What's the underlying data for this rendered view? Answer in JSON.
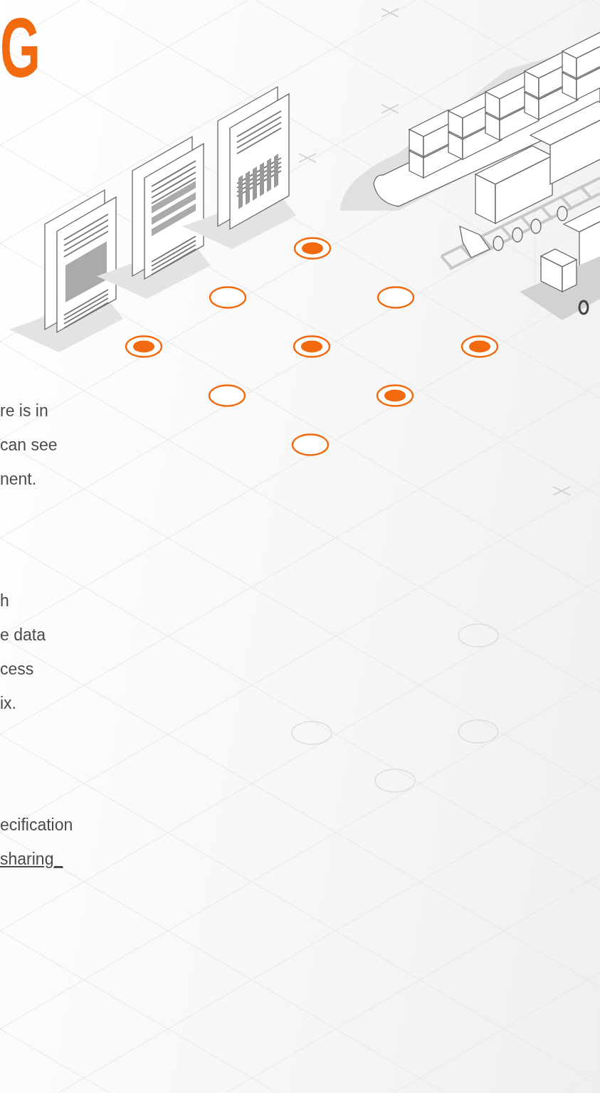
{
  "heading": "G",
  "paragraphs": [
    {
      "lines": [
        "re is in",
        "can see",
        "nent."
      ]
    },
    {
      "lines": [
        "h",
        "e data",
        "cess",
        "ix."
      ]
    },
    {
      "lines": [
        "ecification"
      ],
      "link": "sharing_"
    }
  ],
  "map_nodes": [
    {
      "selected": true
    },
    {
      "selected": false
    },
    {
      "selected": false
    },
    {
      "selected": true
    },
    {
      "selected": true
    },
    {
      "selected": true
    },
    {
      "selected": false
    },
    {
      "selected": true
    },
    {
      "selected": false
    }
  ]
}
